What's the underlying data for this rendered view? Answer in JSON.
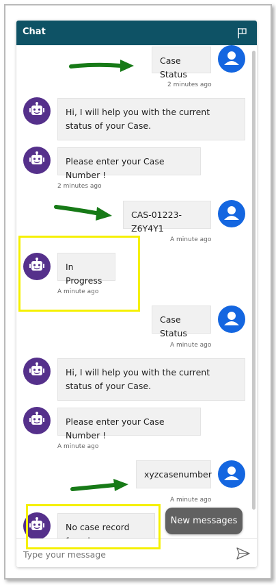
{
  "header": {
    "title": "Chat",
    "flag_icon": "flag-icon"
  },
  "messages": [
    {
      "sender": "user",
      "text": "Case Status",
      "time": "2 minutes ago"
    },
    {
      "sender": "bot",
      "text": "Hi, I will help you with the current status of your Case.",
      "time": ""
    },
    {
      "sender": "bot",
      "text": "Please enter your Case Number !",
      "time": "2 minutes ago"
    },
    {
      "sender": "user",
      "text": "CAS-01223-Z6Y4Y1",
      "time": "A minute ago"
    },
    {
      "sender": "bot",
      "text": "In Progress",
      "time": "A minute ago"
    },
    {
      "sender": "user",
      "text": "Case Status",
      "time": "A minute ago"
    },
    {
      "sender": "bot",
      "text": "Hi, I will help you with the current status of your Case.",
      "time": ""
    },
    {
      "sender": "bot",
      "text": "Please enter your Case Number !",
      "time": "A minute ago"
    },
    {
      "sender": "user",
      "text": "xyzcasenumber",
      "time": "A minute ago"
    },
    {
      "sender": "bot",
      "text": "No case record found",
      "time": ""
    }
  ],
  "new_messages_label": "New messages",
  "composer": {
    "placeholder": "Type your message",
    "value": ""
  },
  "colors": {
    "header_bg": "#0e5265",
    "user_avatar": "#1466e0",
    "bot_avatar": "#55308b",
    "highlight": "#f5f000",
    "annotation_arrow": "#177a17"
  },
  "icons": [
    "flag-icon",
    "user-avatar-icon",
    "bot-avatar-icon",
    "send-icon",
    "arrow-annotation"
  ]
}
